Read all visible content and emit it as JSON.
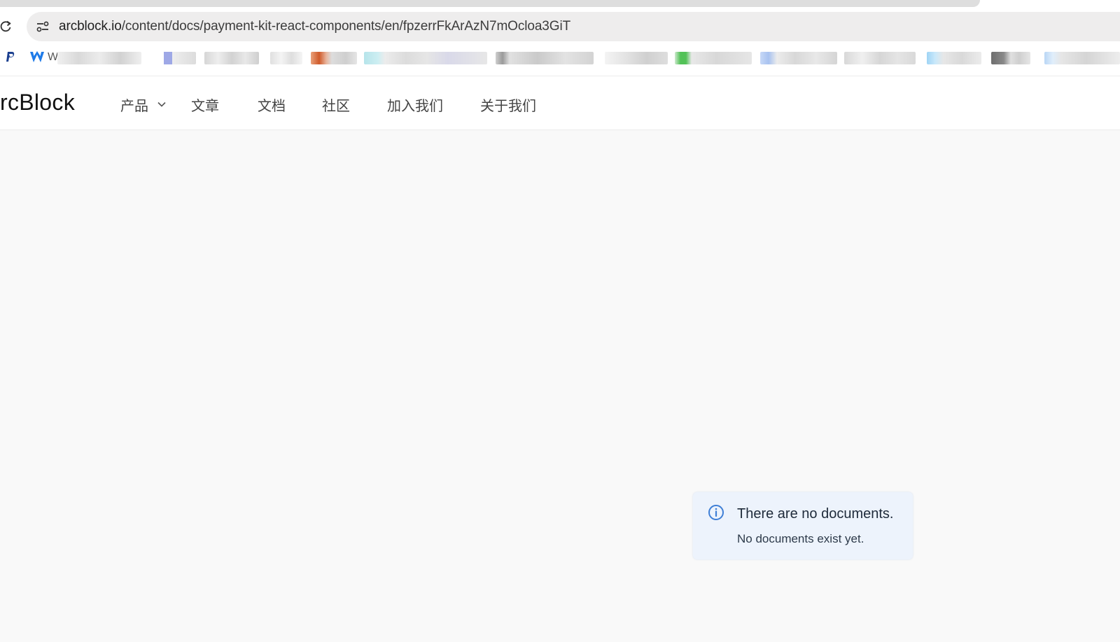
{
  "browser": {
    "url_host": "arcblock.io",
    "url_path": "/content/docs/payment-kit-react-components/en/fpzerrFkArAzN7mOcloa3GiT",
    "bookmarks": {
      "first_label": "W",
      "blurred_colors": [
        "#e3e3e3",
        "#9ea8e6",
        "#d6d6d6",
        "#cf5a2a",
        "#b6e4ea",
        "#cfcfcf",
        "#e1e1e1",
        "#52c257",
        "#a8c2f0",
        "#d8d8d8",
        "#9fd4f5",
        "#6e6e6e",
        "#b9d6f5"
      ]
    }
  },
  "header": {
    "logo_text": "rcBlock",
    "nav": {
      "products": "产品",
      "articles": "文章",
      "docs": "文档",
      "community": "社区",
      "join_us": "加入我们",
      "about_us": "关于我们"
    }
  },
  "alert": {
    "title": "There are no documents.",
    "message": "No documents exist yet.",
    "accent": "#3f7fd6"
  },
  "colors": {
    "page_bg": "#f9f9f9",
    "alert_bg": "#edf3fc"
  }
}
